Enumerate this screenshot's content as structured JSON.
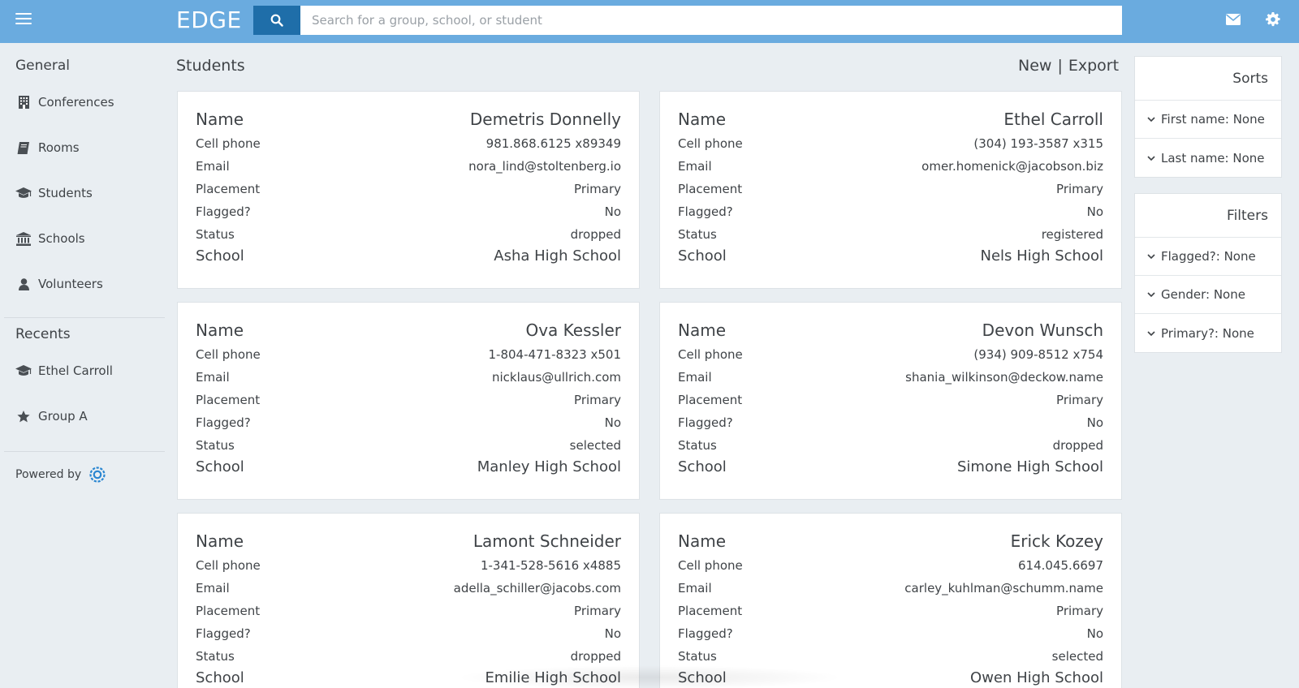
{
  "header": {
    "brand": "EDGE",
    "search_placeholder": "Search for a group, school, or student",
    "icons": [
      "hamburger-menu-icon",
      "search-icon",
      "mail-icon",
      "gear-icon"
    ],
    "bar_color": "#6aabdf",
    "search_button_color": "#1f6ea9"
  },
  "sidebar": {
    "general_heading": "General",
    "general_items": [
      {
        "label": "Conferences",
        "icon": "building-icon"
      },
      {
        "label": "Rooms",
        "icon": "book-icon"
      },
      {
        "label": "Students",
        "icon": "graduation-cap-icon"
      },
      {
        "label": "Schools",
        "icon": "institution-icon"
      },
      {
        "label": "Volunteers",
        "icon": "user-icon"
      }
    ],
    "recents_heading": "Recents",
    "recent_items": [
      {
        "label": "Ethel Carroll",
        "icon": "graduation-cap-icon"
      },
      {
        "label": "Group A",
        "icon": "star-icon"
      }
    ],
    "powered_by": "Powered by"
  },
  "main": {
    "title": "Students",
    "new_label": "New",
    "separator": "|",
    "export_label": "Export",
    "field_labels": {
      "name": "Name",
      "cell_phone": "Cell phone",
      "email": "Email",
      "placement": "Placement",
      "flagged": "Flagged?",
      "status": "Status",
      "school": "School"
    },
    "students": [
      {
        "name": "Demetris Donnelly",
        "cell_phone": "981.868.6125 x89349",
        "email": "nora_lind@stoltenberg.io",
        "placement": "Primary",
        "flagged": "No",
        "status": "dropped",
        "school": "Asha High School"
      },
      {
        "name": "Ethel Carroll",
        "cell_phone": "(304) 193-3587 x315",
        "email": "omer.homenick@jacobson.biz",
        "placement": "Primary",
        "flagged": "No",
        "status": "registered",
        "school": "Nels High School"
      },
      {
        "name": "Ova Kessler",
        "cell_phone": "1-804-471-8323 x501",
        "email": "nicklaus@ullrich.com",
        "placement": "Primary",
        "flagged": "No",
        "status": "selected",
        "school": "Manley High School"
      },
      {
        "name": "Devon Wunsch",
        "cell_phone": "(934) 909-8512 x754",
        "email": "shania_wilkinson@deckow.name",
        "placement": "Primary",
        "flagged": "No",
        "status": "dropped",
        "school": "Simone High School"
      },
      {
        "name": "Lamont Schneider",
        "cell_phone": "1-341-528-5616 x4885",
        "email": "adella_schiller@jacobs.com",
        "placement": "Primary",
        "flagged": "No",
        "status": "dropped",
        "school": "Emilie High School"
      },
      {
        "name": "Erick Kozey",
        "cell_phone": "614.045.6697",
        "email": "carley_kuhlman@schumm.name",
        "placement": "Primary",
        "flagged": "No",
        "status": "selected",
        "school": "Owen High School"
      }
    ]
  },
  "right_panel": {
    "sorts_heading": "Sorts",
    "sorts": [
      "First name: None",
      "Last name: None"
    ],
    "filters_heading": "Filters",
    "filters": [
      "Flagged?: None",
      "Gender: None",
      "Primary?: None"
    ]
  }
}
